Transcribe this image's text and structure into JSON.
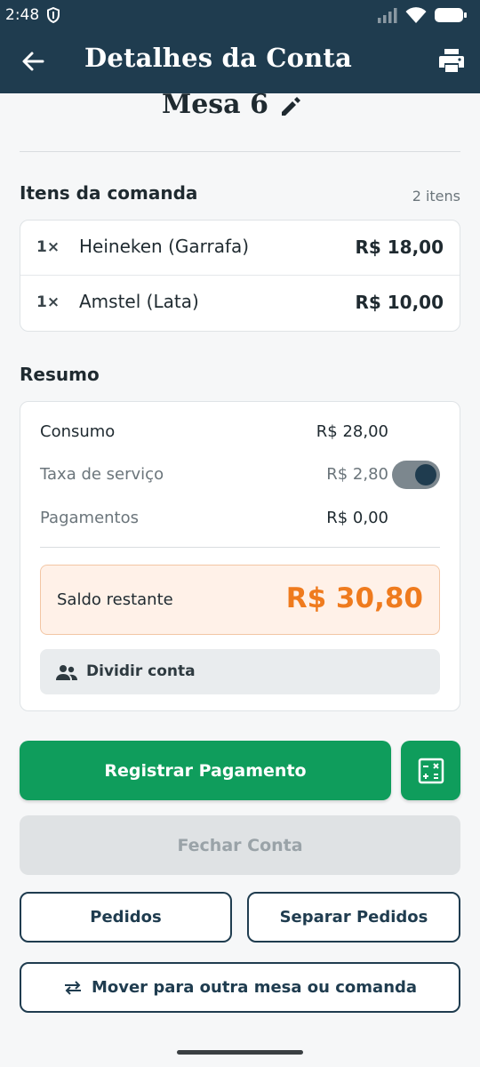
{
  "status_bar": {
    "time": "2:48"
  },
  "header": {
    "title": "Detalhes da Conta"
  },
  "table": {
    "name": "Mesa 6"
  },
  "items_section": {
    "title": "Itens da comanda",
    "count": "2 itens",
    "items": [
      {
        "qty": "1×",
        "name": "Heineken (Garrafa)",
        "price": "R$ 18,00"
      },
      {
        "qty": "1×",
        "name": "Amstel (Lata)",
        "price": "R$ 10,00"
      }
    ]
  },
  "summary": {
    "title": "Resumo",
    "consumo_label": "Consumo",
    "consumo_value": "R$ 28,00",
    "taxa_label": "Taxa de serviço",
    "taxa_value": "R$ 2,80",
    "taxa_enabled": true,
    "pagamentos_label": "Pagamentos",
    "pagamentos_value": "R$ 0,00",
    "saldo_label": "Saldo restante",
    "saldo_value": "R$ 30,80",
    "dividir_label": "Dividir conta"
  },
  "actions": {
    "registrar": "Registrar Pagamento",
    "fechar": "Fechar Conta",
    "pedidos": "Pedidos",
    "separar": "Separar Pedidos",
    "mover": "Mover para outra mesa ou comanda"
  },
  "colors": {
    "header_bg": "#1f3c4f",
    "primary_green": "#0f9d5c",
    "saldo_orange": "#ef7b1e"
  }
}
